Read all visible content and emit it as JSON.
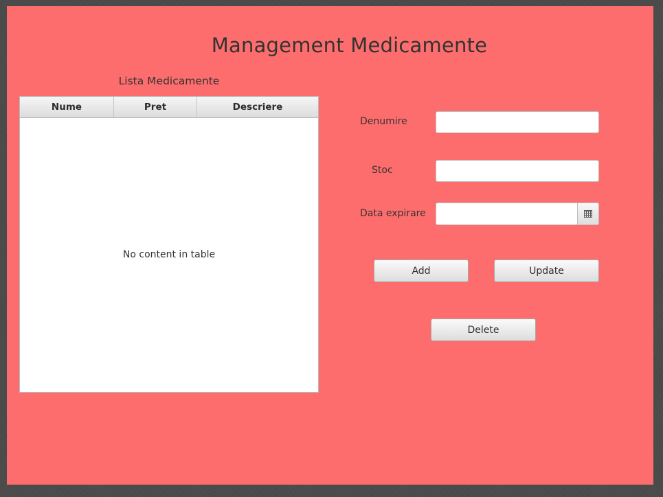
{
  "header": {
    "title": "Management Medicamente"
  },
  "table": {
    "title": "Lista Medicamente",
    "columns": [
      "Nume",
      "Pret",
      "Descriere"
    ],
    "rows": [],
    "placeholder": "No content in table"
  },
  "form": {
    "denumire_label": "Denumire",
    "denumire_value": "",
    "stoc_label": "Stoc",
    "stoc_value": "",
    "data_label": "Data expirare",
    "data_value": ""
  },
  "buttons": {
    "add": "Add",
    "update": "Update",
    "delete": "Delete"
  },
  "icons": {
    "date_picker": "calendar-icon"
  },
  "colors": {
    "background": "#fe6d6d",
    "text": "#333333"
  }
}
